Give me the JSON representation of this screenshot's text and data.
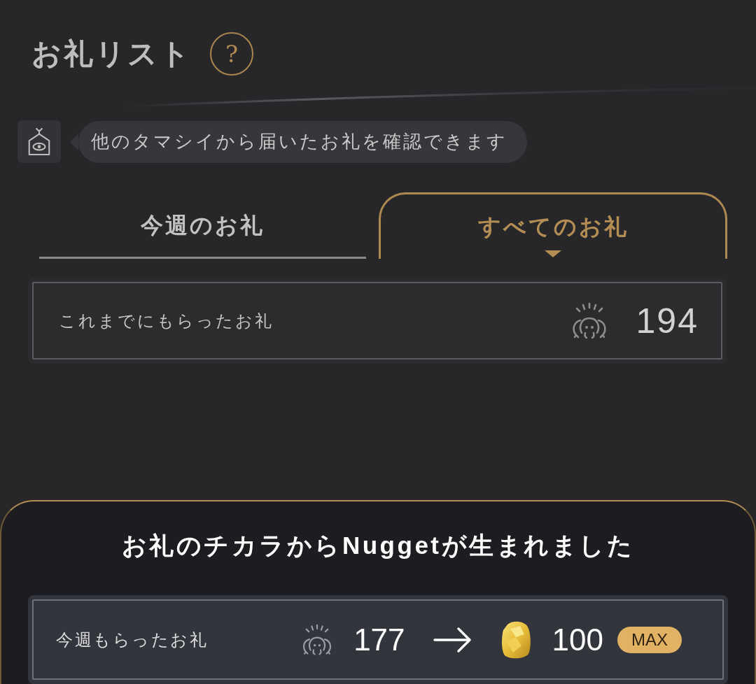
{
  "header": {
    "title": "お礼リスト",
    "help": "?"
  },
  "notice": {
    "text": "他のタマシイから届いたお礼を確認できます"
  },
  "tabs": [
    {
      "label": "今週のお礼",
      "selected": false
    },
    {
      "label": "すべてのお礼",
      "selected": true
    }
  ],
  "total": {
    "label": "これまでにもらったお礼",
    "count": "194"
  },
  "nugget_panel": {
    "title": "お礼のチカラからNuggetが生まれました",
    "weekly": {
      "label": "今週もらったお礼",
      "count": "177",
      "nuggets": "100",
      "badge": "MAX"
    }
  }
}
